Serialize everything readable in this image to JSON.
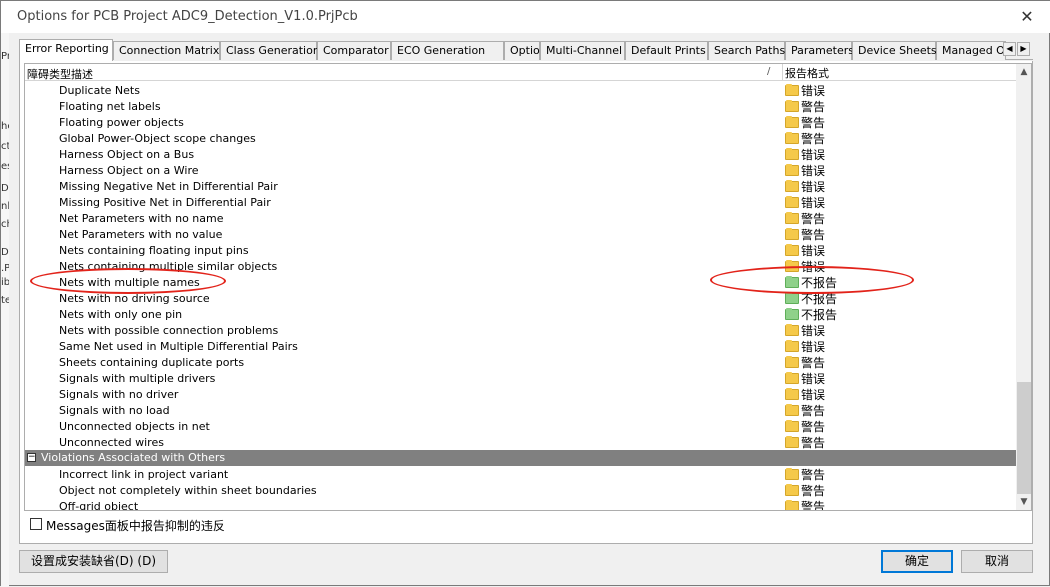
{
  "window": {
    "title": "Options for PCB Project ADC9_Detection_V1.0.PrjPcb",
    "close_glyph": "✕"
  },
  "background_fragments": [
    "Pr",
    "he",
    "ct",
    "es",
    "D",
    "nl",
    "ch",
    "D",
    ".P",
    "ib",
    "te"
  ],
  "tabs": [
    {
      "label": "Error Reporting",
      "active": true
    },
    {
      "label": "Connection Matrix"
    },
    {
      "label": "Class Generation"
    },
    {
      "label": "Comparator"
    },
    {
      "label": "ECO Generation"
    },
    {
      "label": "Options"
    },
    {
      "label": "Multi-Channel"
    },
    {
      "label": "Default Prints"
    },
    {
      "label": "Search Paths"
    },
    {
      "label": "Parameters"
    },
    {
      "label": "Device Sheets"
    },
    {
      "label": "Managed O"
    }
  ],
  "tab_scroll": {
    "left": "◀",
    "right": "▶"
  },
  "grid": {
    "header_desc": "障碍类型描述",
    "header_sort": "/",
    "header_format": "报告格式",
    "rows": [
      {
        "name": "Duplicate Nets",
        "format": "错误",
        "color": "yellow"
      },
      {
        "name": "Floating net labels",
        "format": "警告",
        "color": "yellow"
      },
      {
        "name": "Floating power objects",
        "format": "警告",
        "color": "yellow"
      },
      {
        "name": "Global Power-Object scope changes",
        "format": "警告",
        "color": "yellow"
      },
      {
        "name": "Harness Object on a Bus",
        "format": "错误",
        "color": "yellow"
      },
      {
        "name": "Harness Object on a Wire",
        "format": "错误",
        "color": "yellow"
      },
      {
        "name": "Missing Negative Net in Differential Pair",
        "format": "错误",
        "color": "yellow"
      },
      {
        "name": "Missing Positive Net in Differential Pair",
        "format": "错误",
        "color": "yellow"
      },
      {
        "name": "Net Parameters with no name",
        "format": "警告",
        "color": "yellow"
      },
      {
        "name": "Net Parameters with no value",
        "format": "警告",
        "color": "yellow"
      },
      {
        "name": "Nets containing floating input pins",
        "format": "错误",
        "color": "yellow"
      },
      {
        "name": "Nets containing multiple similar objects",
        "format": "错误",
        "color": "yellow"
      },
      {
        "name": "Nets with multiple names",
        "format": "不报告",
        "color": "green"
      },
      {
        "name": "Nets with no driving source",
        "format": "不报告",
        "color": "green"
      },
      {
        "name": "Nets with only one pin",
        "format": "不报告",
        "color": "green"
      },
      {
        "name": "Nets with possible connection problems",
        "format": "错误",
        "color": "yellow"
      },
      {
        "name": "Same Net used in Multiple Differential Pairs",
        "format": "错误",
        "color": "yellow"
      },
      {
        "name": "Sheets containing duplicate ports",
        "format": "警告",
        "color": "yellow"
      },
      {
        "name": "Signals with multiple drivers",
        "format": "错误",
        "color": "yellow"
      },
      {
        "name": "Signals with no driver",
        "format": "错误",
        "color": "yellow"
      },
      {
        "name": "Signals with no load",
        "format": "警告",
        "color": "yellow"
      },
      {
        "name": "Unconnected objects in net",
        "format": "警告",
        "color": "yellow"
      },
      {
        "name": "Unconnected wires",
        "format": "警告",
        "color": "yellow"
      }
    ],
    "group": {
      "toggle": "−",
      "title": "Violations Associated with Others"
    },
    "group_rows": [
      {
        "name": "Incorrect link in project variant",
        "format": "警告",
        "color": "yellow"
      },
      {
        "name": "Object not completely within sheet boundaries",
        "format": "警告",
        "color": "yellow"
      },
      {
        "name": "Off-grid object",
        "format": "警告",
        "color": "yellow"
      }
    ],
    "scroll_up": "▲",
    "scroll_down": "▼"
  },
  "suppress_label": "Messages面板中报告抑制的违反",
  "buttons": {
    "set_default": "设置成安装缺省(D) (D)",
    "ok": "确定",
    "cancel": "取消"
  },
  "colors": {
    "highlight_ellipse": "#e2231a",
    "group_bg": "#808080",
    "default_button_border": "#0078d7"
  }
}
